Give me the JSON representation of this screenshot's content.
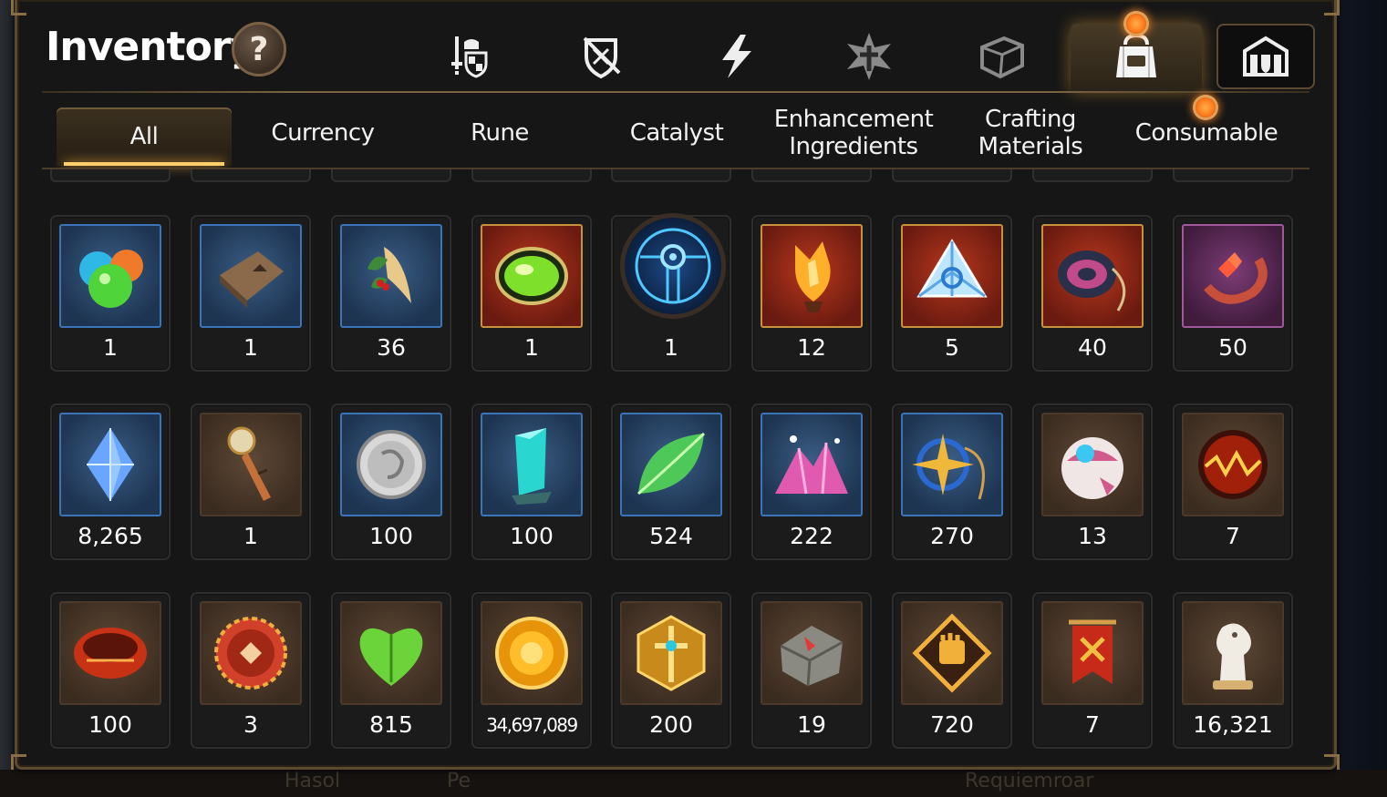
{
  "title": "Inventory",
  "help_label": "?",
  "category_icons": [
    {
      "name": "gear-sword-shield-icon",
      "state": "normal"
    },
    {
      "name": "slashed-shield-icon",
      "state": "normal"
    },
    {
      "name": "lightning-icon",
      "state": "normal"
    },
    {
      "name": "artifact-cross-icon",
      "state": "dim"
    },
    {
      "name": "crate-icon",
      "state": "dim"
    },
    {
      "name": "bag-icon",
      "state": "selected",
      "notification": true
    },
    {
      "name": "fortress-icon",
      "state": "boxed"
    }
  ],
  "tabs": [
    {
      "label": "All",
      "active": true
    },
    {
      "label": "Currency"
    },
    {
      "label": "Rune"
    },
    {
      "label": "Catalyst"
    },
    {
      "label": "Enhancement\nIngredients"
    },
    {
      "label": "Crafting\nMaterials"
    },
    {
      "label": "Consumable",
      "notification": true
    }
  ],
  "items": [
    {
      "icon": "slime-orbs-icon",
      "bg": "blue",
      "count": "1"
    },
    {
      "icon": "leather-pouch-icon",
      "bg": "blue",
      "count": "1"
    },
    {
      "icon": "ginseng-root-icon",
      "bg": "blue",
      "count": "36"
    },
    {
      "icon": "green-orb-icon",
      "bg": "red",
      "count": "1"
    },
    {
      "icon": "blue-rune-disc-icon",
      "bg": "round",
      "count": "1"
    },
    {
      "icon": "flame-crystal-icon",
      "bg": "red",
      "count": "12"
    },
    {
      "icon": "triangle-crystal-icon",
      "bg": "red",
      "count": "5"
    },
    {
      "icon": "eye-pendant-icon",
      "bg": "red",
      "count": "40"
    },
    {
      "icon": "flower-ring-icon",
      "bg": "purple",
      "count": "50"
    },
    {
      "icon": "blue-gem-icon",
      "bg": "blue",
      "count": "8,265"
    },
    {
      "icon": "compass-dagger-icon",
      "bg": "brown",
      "count": "1"
    },
    {
      "icon": "silver-coin-icon",
      "bg": "blue",
      "count": "100"
    },
    {
      "icon": "teal-crystal-icon",
      "bg": "blue",
      "count": "100"
    },
    {
      "icon": "leaf-icon",
      "bg": "blue",
      "count": "524"
    },
    {
      "icon": "pink-crystal-pile-icon",
      "bg": "blue",
      "count": "222"
    },
    {
      "icon": "star-amulet-icon",
      "bg": "blue",
      "count": "270"
    },
    {
      "icon": "robot-pod-icon",
      "bg": "brown",
      "count": "13"
    },
    {
      "icon": "lava-orb-icon",
      "bg": "brown",
      "count": "7"
    },
    {
      "icon": "red-bracelet-icon",
      "bg": "brown",
      "count": "100"
    },
    {
      "icon": "bottle-cap-badge-icon",
      "bg": "brown",
      "count": "3"
    },
    {
      "icon": "green-heart-icon",
      "bg": "brown",
      "count": "815"
    },
    {
      "icon": "gold-sun-coin-icon",
      "bg": "brown",
      "count": "34,697,089",
      "small": true
    },
    {
      "icon": "gold-sword-emblem-icon",
      "bg": "brown",
      "count": "200"
    },
    {
      "icon": "stone-compass-icon",
      "bg": "brown",
      "count": "19"
    },
    {
      "icon": "fist-emblem-icon",
      "bg": "brown",
      "count": "720"
    },
    {
      "icon": "war-banner-icon",
      "bg": "brown",
      "count": "7"
    },
    {
      "icon": "knight-chess-icon",
      "bg": "brown",
      "count": "16,321"
    }
  ],
  "background_text": [
    "Hasol",
    "Pe",
    "Requiemroar"
  ],
  "colors": {
    "accent": "#ffcf6b",
    "panel_border": "#5b4a32",
    "notify": "#ff7a1a"
  }
}
